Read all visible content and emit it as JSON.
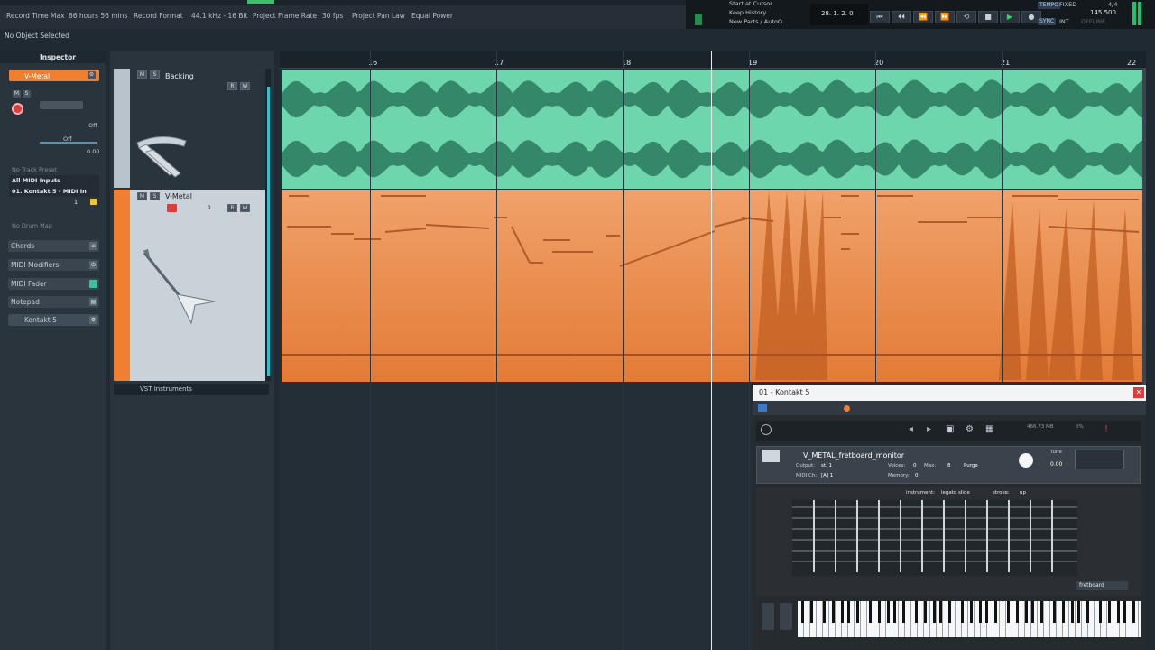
{
  "status": {
    "record_time_label": "Record Time Max",
    "record_time_value": "86 hours 56 mins",
    "record_format_label": "Record Format",
    "record_format_value": "44.1 kHz - 16 Bit",
    "frame_rate_label": "Project Frame Rate",
    "frame_rate_value": "30 fps",
    "pan_law_label": "Project Pan Law",
    "pan_law_value": "Equal Power",
    "selection_label": "No Object Selected"
  },
  "transport": {
    "menu": [
      "Start at Cursor",
      "Keep History",
      "New Parts / AutoQ"
    ],
    "position": "28. 1. 2. 0",
    "tempo_label": "TEMPO",
    "tempo_mode": "FIXED",
    "signature": "4/4",
    "tempo_value": "145.500",
    "sync_label": "SYNC",
    "int_label": "INT",
    "offline_label": "OFFLINE"
  },
  "inspector": {
    "title": "Inspector",
    "track_name": "V-Metal",
    "off1": "Off",
    "off2": "Off",
    "volume": "0.00",
    "no_track_preset": "No Track Preset",
    "input": "All MIDI Inputs",
    "output": "01. Kontakt 5 - MIDI In",
    "channel": "1",
    "no_drum_map": "No Drum Map",
    "sections": [
      "Chords",
      "MIDI Modifiers",
      "MIDI Fader",
      "Notepad"
    ],
    "instrument_section": "Kontakt 5"
  },
  "tracks": {
    "backing_name": "Backing",
    "vmetal_name": "V-Metal",
    "folder_name": "VST Instruments",
    "btn_m": "M",
    "btn_s": "S",
    "btn_r": "R",
    "btn_w": "W",
    "channel_num": "1"
  },
  "ruler": [
    "16",
    "17",
    "18",
    "19",
    "20",
    "21",
    "22"
  ],
  "kontakt": {
    "window_title": "01 - Kontakt 5",
    "instrument_name": "V_METAL_fretboard_monitor",
    "output_label": "Output:",
    "output_value": "st. 1",
    "voices_label": "Voices:",
    "voices_value": "0",
    "max_label": "Max:",
    "max_value": "8",
    "purge_label": "Purge",
    "midi_label": "MIDI Ch:",
    "midi_value": "[A] 1",
    "memory_label": "Memory:",
    "memory_value": "0",
    "tune_label": "Tune",
    "tune_value": "0.00",
    "instrument_label": "instrument:",
    "instrument_value": "legato slide",
    "stroke_label": "stroke:",
    "stroke_value": "up",
    "fretboard_select": "fretboard",
    "memory_stat": "466.73 MB",
    "cpu_label": "Cpu",
    "cpu_value": "0%",
    "disk_label": "Disk",
    "disk_value": "0%"
  },
  "colors": {
    "audio_clip": "#6ed6ac",
    "midi_clip": "#e6894a",
    "accent": "#f08030",
    "record": "#e03c3c"
  }
}
